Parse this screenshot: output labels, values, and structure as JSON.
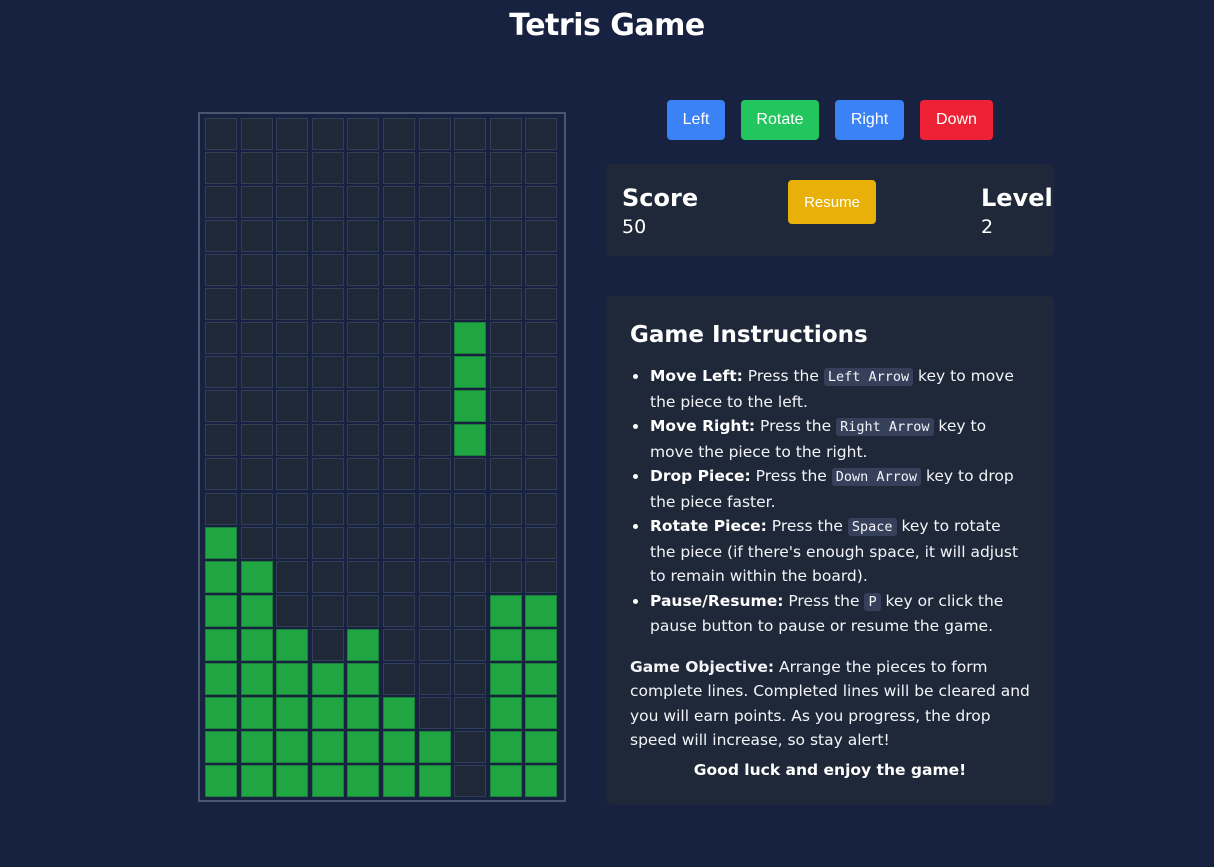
{
  "title": "Tetris Game",
  "colors": {
    "background": "#172140",
    "block": "#1fa643",
    "empty_cell": "#1f2837",
    "left_button": "#3b82f6",
    "rotate_button": "#22c55e",
    "right_button": "#3b82f6",
    "down_button": "#ef2235",
    "resume_button": "#e8b008"
  },
  "controls": {
    "left": "Left",
    "rotate": "Rotate",
    "right": "Right",
    "down": "Down"
  },
  "stats": {
    "score_label": "Score",
    "score": "50",
    "resume_label": "Resume",
    "level_label": "Level",
    "level": "2"
  },
  "board": {
    "columns": 10,
    "rows": 20,
    "filled": [
      "..........",
      "..........",
      "..........",
      "..........",
      "..........",
      "..........",
      ".......#..",
      ".......#..",
      ".......#..",
      ".......#..",
      "..........",
      "..........",
      "#.........",
      "##........",
      "##......##",
      "###.#...##",
      "#####...##",
      "######..##",
      "#######.##",
      "#######.##"
    ]
  },
  "instructions": {
    "title": "Game Instructions",
    "items": [
      {
        "label": "Move Left:",
        "pre": " Press the ",
        "key": "Left Arrow",
        "post": " key to move the piece to the left."
      },
      {
        "label": "Move Right:",
        "pre": " Press the ",
        "key": "Right Arrow",
        "post": " key to move the piece to the right."
      },
      {
        "label": "Drop Piece:",
        "pre": " Press the ",
        "key": "Down Arrow",
        "post": " key to drop the piece faster."
      },
      {
        "label": "Rotate Piece:",
        "pre": " Press the ",
        "key": "Space",
        "post": " key to rotate the piece (if there's enough space, it will adjust to remain within the board)."
      },
      {
        "label": "Pause/Resume:",
        "pre": " Press the ",
        "key": "P",
        "post": " key or click the pause button to pause or resume the game."
      }
    ],
    "objective_label": "Game Objective:",
    "objective_text": " Arrange the pieces to form complete lines. Completed lines will be cleared and you will earn points. As you progress, the drop speed will increase, so stay alert!",
    "good_luck": "Good luck and enjoy the game!"
  }
}
